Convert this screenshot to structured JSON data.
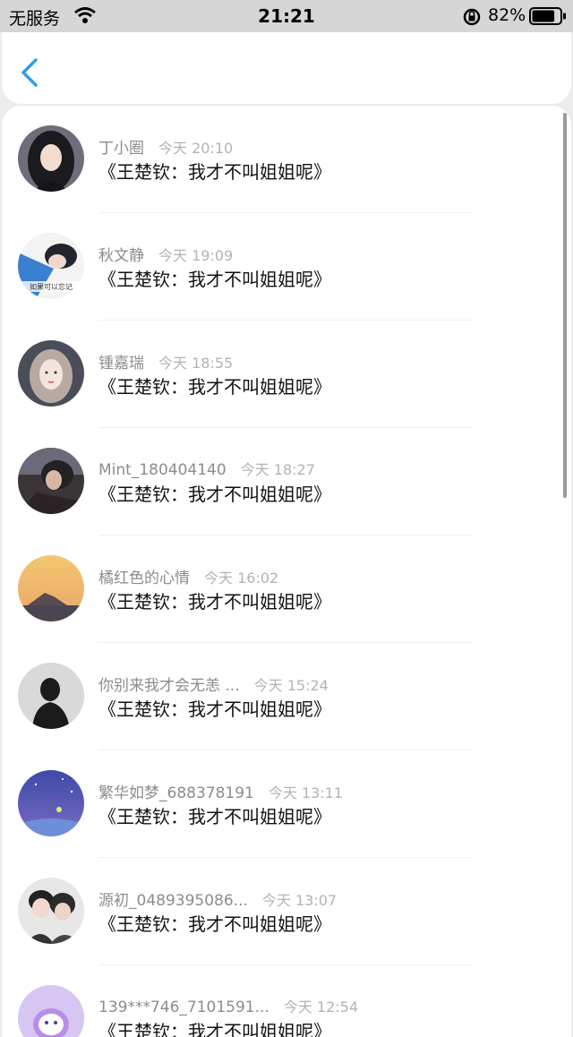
{
  "status_bar": {
    "carrier": "无服务",
    "time": "21:21",
    "battery_percent": "82%",
    "battery_level": 0.82
  },
  "nav": {
    "back_icon": "chevron-left-icon"
  },
  "colors": {
    "accent": "#2f9ee8",
    "name": "#8c8c8c",
    "time": "#b3b3b3",
    "message": "#111111"
  },
  "comments": [
    {
      "name": "丁小圈",
      "time": "今天 20:10",
      "message": "《王楚钦：我才不叫姐姐呢》",
      "avatar": "avatar-girl-dark-hair"
    },
    {
      "name": "秋文静",
      "time": "今天 19:09",
      "message": "《王楚钦：我才不叫姐姐呢》",
      "avatar": "avatar-girl-blue"
    },
    {
      "name": "锺嘉瑞",
      "time": "今天 18:55",
      "message": "《王楚钦：我才不叫姐姐呢》",
      "avatar": "avatar-illustration"
    },
    {
      "name": "Mint_180404140",
      "time": "今天 18:27",
      "message": "《王楚钦：我才不叫姐姐呢》",
      "avatar": "avatar-portrait"
    },
    {
      "name": "橘红色的心情",
      "time": "今天 16:02",
      "message": "《王楚钦：我才不叫姐姐呢》",
      "avatar": "avatar-sunset-mountain"
    },
    {
      "name": "你别来我才会无恙 ...",
      "time": "今天 15:24",
      "message": "《王楚钦：我才不叫姐姐呢》",
      "avatar": "avatar-silhouette"
    },
    {
      "name": "繁华如梦_688378191",
      "time": "今天 13:11",
      "message": "《王楚钦：我才不叫姐姐呢》",
      "avatar": "avatar-night-sky"
    },
    {
      "name": "源初_0489395086...",
      "time": "今天 13:07",
      "message": "《王楚钦：我才不叫姐姐呢》",
      "avatar": "avatar-couple"
    },
    {
      "name": "139***746_7101591...",
      "time": "今天 12:54",
      "message": "《王楚钦：我才不叫姐姐呢》",
      "avatar": "avatar-purple-cartoon"
    }
  ]
}
